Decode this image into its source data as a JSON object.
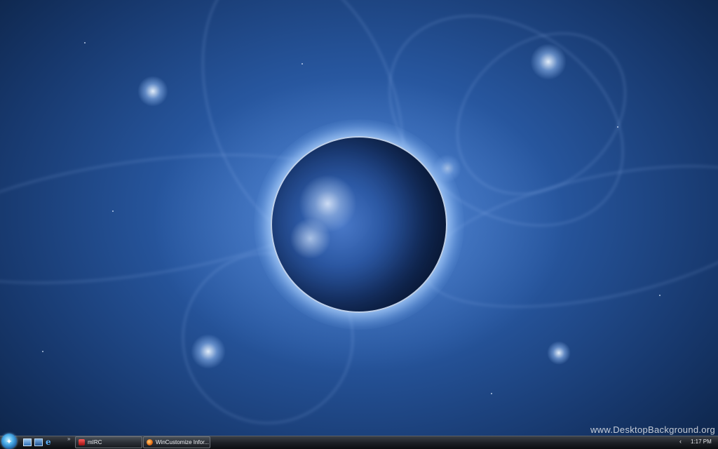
{
  "desktop": {
    "wallpaper": "blue planet in space with glowing energy wisps",
    "watermark": "www.DesktopBackground.org"
  },
  "taskbar": {
    "start_icon": "windows-orb-icon",
    "quick_launch": [
      "show-desktop-icon",
      "switch-windows-icon",
      "internet-explorer-icon"
    ],
    "more_label": "»",
    "tasks": [
      {
        "label": "mIRC",
        "icon": "mirc-icon"
      },
      {
        "label": "WinCustomize Infor...",
        "icon": "firefox-icon"
      }
    ],
    "tray_chevron": "‹",
    "clock": "1:17 PM"
  },
  "colors": {
    "space_dark": "#0d2448",
    "space_mid": "#27569e",
    "glow": "#c8deff",
    "taskbar": "#1d2026"
  }
}
